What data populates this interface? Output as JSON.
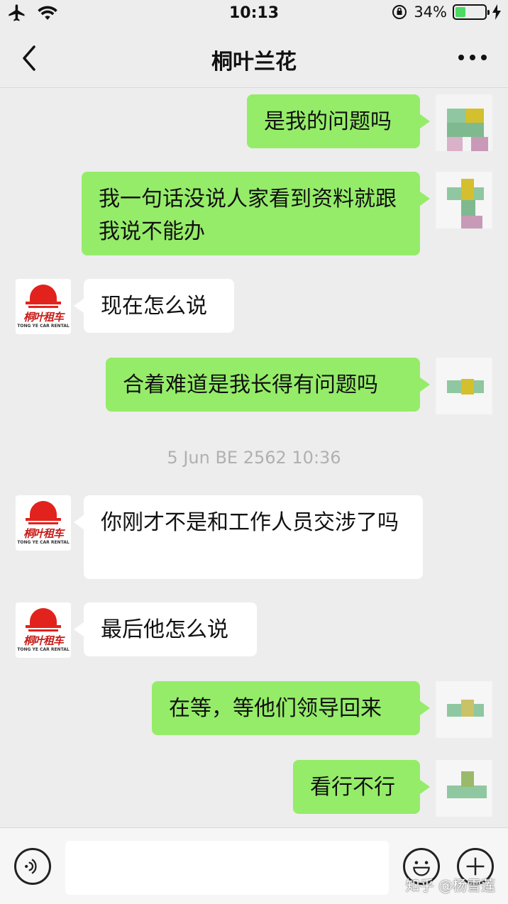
{
  "status": {
    "time": "10:13",
    "battery_percent_text": "34%",
    "battery_level": 0.34
  },
  "nav": {
    "title": "桐叶兰花"
  },
  "avatar_other": {
    "brand": "桐叶租车",
    "sub": "TONG YE CAR RENTAL"
  },
  "messages": [
    {
      "sender": "me",
      "text": "是我的问题吗"
    },
    {
      "sender": "me",
      "text": "我一句话没说人家看到资料就跟我说不能办"
    },
    {
      "sender": "other",
      "text": "现在怎么说"
    },
    {
      "sender": "me",
      "text": "合着难道是我长得有问题吗"
    },
    {
      "sender": "other",
      "text": "你刚才不是和工作人员交涉了吗"
    },
    {
      "sender": "other",
      "text": "最后他怎么说"
    },
    {
      "sender": "me",
      "text": "在等，等他们领导回来"
    },
    {
      "sender": "me",
      "text": "看行不行"
    }
  ],
  "timestamp": "5 Jun BE 2562 10:36",
  "input": {
    "value": "",
    "placeholder": ""
  },
  "watermark": "知乎 @杨雪莲",
  "colors": {
    "my_bubble": "#95ec69",
    "other_bubble": "#ffffff",
    "background": "#ededed",
    "brand_red": "#e2221c"
  }
}
